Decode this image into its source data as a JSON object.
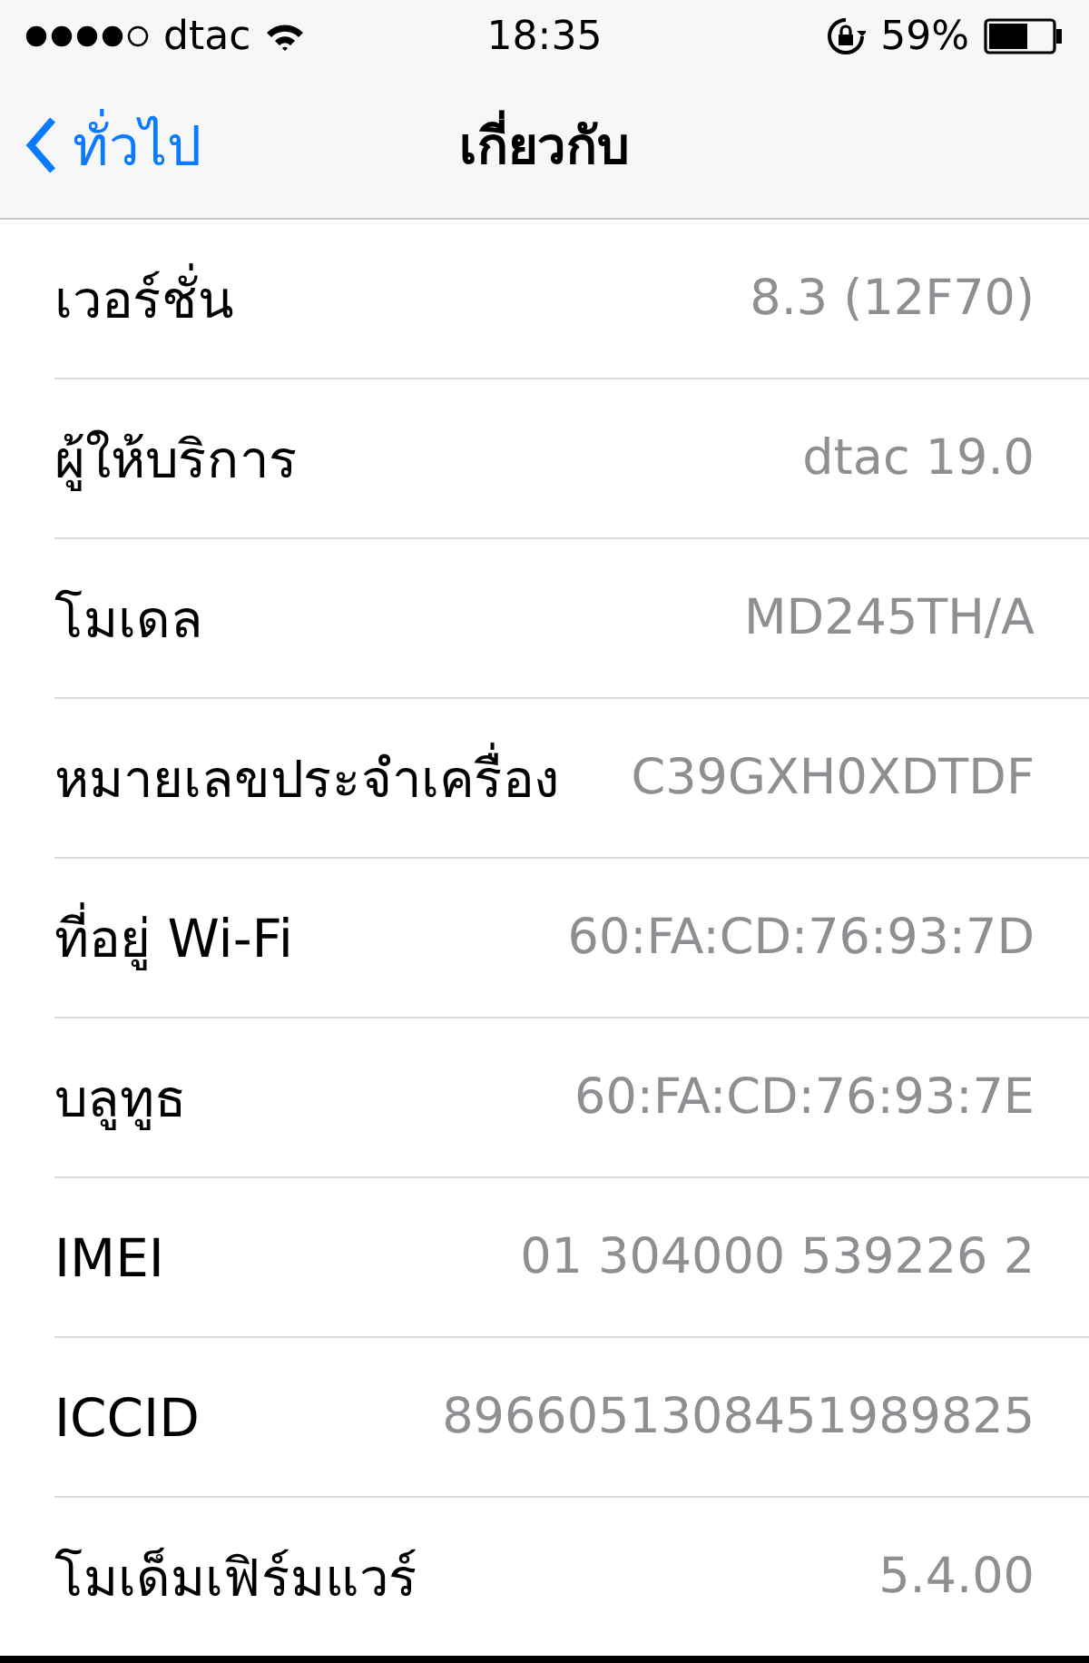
{
  "status_bar": {
    "carrier": "dtac",
    "time": "18:35",
    "battery": "59%"
  },
  "nav": {
    "back": "ทั่วไป",
    "title": "เกี่ยวกับ"
  },
  "rows": [
    {
      "label": "เวอร์ชั่น",
      "value": "8.3 (12F70)"
    },
    {
      "label": "ผู้ให้บริการ",
      "value": "dtac 19.0"
    },
    {
      "label": "โมเดล",
      "value": "MD245TH/A"
    },
    {
      "label": "หมายเลขประจำเครื่อง",
      "value": "C39GXH0XDTDF"
    },
    {
      "label": "ที่อยู่ Wi-Fi",
      "value": "60:FA:CD:76:93:7D"
    },
    {
      "label": "บลูทูธ",
      "value": "60:FA:CD:76:93:7E"
    },
    {
      "label": "IMEI",
      "value": "01 304000 539226 2"
    },
    {
      "label": "ICCID",
      "value": "8966051308451989825"
    },
    {
      "label": "โมเด็มเฟิร์มแวร์",
      "value": "5.4.00"
    }
  ]
}
